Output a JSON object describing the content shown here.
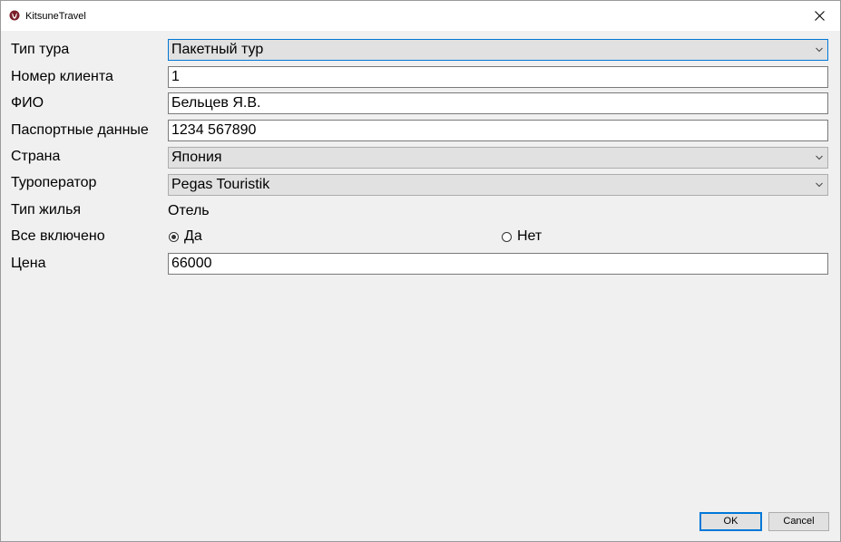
{
  "window": {
    "title": "KitsuneTravel"
  },
  "form": {
    "tour_type": {
      "label": "Тип тура",
      "value": "Пакетный тур"
    },
    "client_number": {
      "label": "Номер клиента",
      "value": "1"
    },
    "full_name": {
      "label": "ФИО",
      "value": "Бельцев Я.В."
    },
    "passport": {
      "label": "Паспортные данные",
      "value": "1234 567890"
    },
    "country": {
      "label": "Страна",
      "value": "Япония"
    },
    "tour_operator": {
      "label": "Туроператор",
      "value": "Pegas Touristik"
    },
    "housing_type": {
      "label": "Тип жилья",
      "value": "Отель"
    },
    "all_inclusive": {
      "label": "Все включено",
      "options": [
        {
          "label": "Да",
          "checked": true
        },
        {
          "label": "Нет",
          "checked": false
        }
      ]
    },
    "price": {
      "label": "Цена",
      "value": "66000"
    }
  },
  "buttons": {
    "ok_label": "OK",
    "cancel_label": "Cancel"
  },
  "icons": {
    "app": "fox-logo-icon",
    "close": "close-icon",
    "dropdown": "chevron-down-icon"
  },
  "colors": {
    "focus_border": "#0078d7",
    "window_bg": "#f0f0f0",
    "titlebar_bg": "#ffffff"
  }
}
